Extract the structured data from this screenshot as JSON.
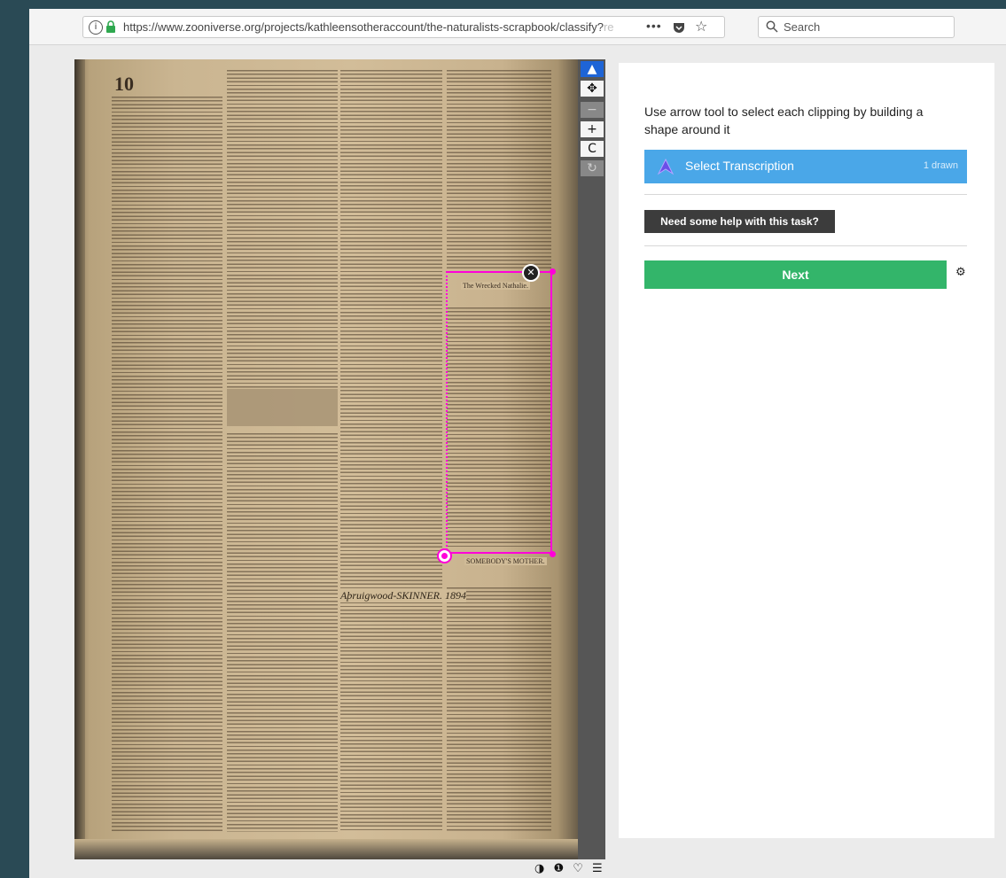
{
  "browser": {
    "url_main": "https://www.zooniverse.org/projects/kathleensotheraccount/the-naturalists-scrapbook/classify?",
    "url_faded": "re",
    "more_label": "•••",
    "search_placeholder": "Search"
  },
  "subject": {
    "page_number": "10",
    "clipping_title": "The Wrecked Nathalie.",
    "clipping_title_2": "SOMEBODY'S MOTHER.",
    "handwritten_note": "Aþruigwood-SKINNER. 1894"
  },
  "viewer_tools": {
    "pointer": "▲",
    "move": "✥",
    "zoom_out": "−",
    "zoom_in": "+",
    "reset": "C",
    "rotate": "↻"
  },
  "viewer_footer": "◑ ❶ ♡ ☰",
  "task": {
    "instruction": "Use arrow tool to select each clipping by building a shape around it",
    "tool_label": "Select Transcription",
    "tool_count": "1 drawn",
    "help_label": "Need some help with this task?",
    "next_label": "Next"
  },
  "colors": {
    "tool_blue": "#4aa7e8",
    "next_green": "#33b56a",
    "selection_magenta": "#ff00d9"
  }
}
